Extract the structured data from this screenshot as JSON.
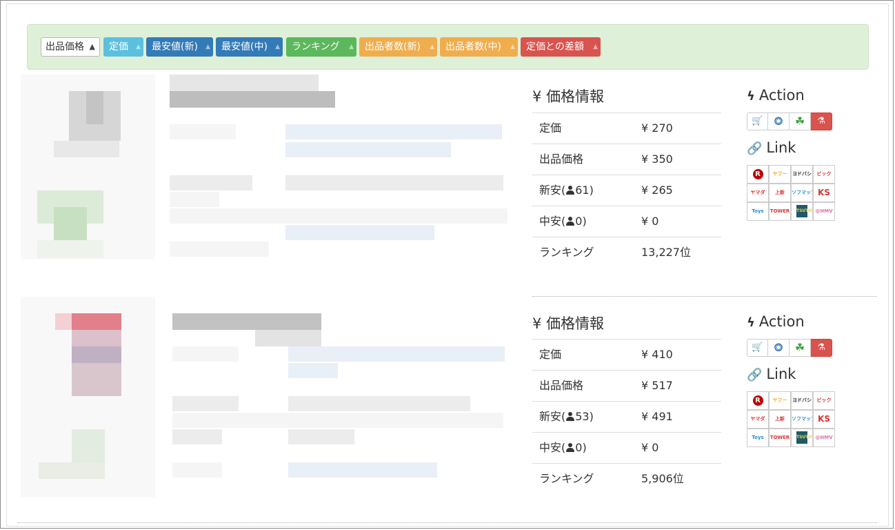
{
  "toolbar": {
    "select_value": "出品価格",
    "buttons": [
      {
        "label": "定価",
        "style": "info"
      },
      {
        "label": "最安値(新)",
        "style": "primary"
      },
      {
        "label": "最安値(中)",
        "style": "primary"
      },
      {
        "label": "ランキング",
        "style": "success"
      },
      {
        "label": "出品者数(新)",
        "style": "warning"
      },
      {
        "label": "出品者数(中)",
        "style": "warning"
      },
      {
        "label": "定価との差額",
        "style": "danger"
      }
    ]
  },
  "colors": {
    "info": "#5bc0de",
    "primary": "#337ab7",
    "success": "#5cb85c",
    "warning": "#f0ad4e",
    "danger": "#d9534f",
    "alert_bg": "#dff0d8"
  },
  "products": [
    {
      "price_title": "価格情報",
      "currency_icon": "¥",
      "list_price": {
        "label": "定価",
        "value": "¥ 270"
      },
      "listing_price": {
        "label": "出品価格",
        "value": "¥ 350"
      },
      "new_low": {
        "label_prefix": "新安(",
        "count": "61",
        "label_suffix": ")",
        "value": "¥ 265"
      },
      "used_low": {
        "label_prefix": "中安(",
        "count": "0",
        "label_suffix": ")",
        "value": "¥ 0"
      },
      "ranking": {
        "label": "ランキング",
        "value": "13,227位"
      },
      "action_title": "Action",
      "link_title": "Link"
    },
    {
      "price_title": "価格情報",
      "currency_icon": "¥",
      "list_price": {
        "label": "定価",
        "value": "¥ 410"
      },
      "listing_price": {
        "label": "出品価格",
        "value": "¥ 517"
      },
      "new_low": {
        "label_prefix": "新安(",
        "count": "53",
        "label_suffix": ")",
        "value": "¥ 491"
      },
      "used_low": {
        "label_prefix": "中安(",
        "count": "0",
        "label_suffix": ")",
        "value": "¥ 0"
      },
      "ranking": {
        "label": "ランキング",
        "value": "5,906位"
      },
      "action_title": "Action",
      "link_title": "Link"
    }
  ],
  "action_icons": [
    "cart-icon",
    "monitor-icon",
    "clover-icon",
    "flask-icon"
  ],
  "link_icons": [
    {
      "name": "rakuten-icon",
      "text": "R"
    },
    {
      "name": "yahoo-shopping-icon",
      "text": "ヤフー"
    },
    {
      "name": "yodobashi-icon",
      "text": "ヨドバシ"
    },
    {
      "name": "bic-camera-icon",
      "text": "ビック"
    },
    {
      "name": "yamada-icon",
      "text": "ヤマダ"
    },
    {
      "name": "joshin-icon",
      "text": "上新"
    },
    {
      "name": "sofmap-icon",
      "text": "ソフマップ"
    },
    {
      "name": "ks-denki-icon",
      "text": "KS"
    },
    {
      "name": "toysrus-icon",
      "text": "Toys"
    },
    {
      "name": "tower-records-icon",
      "text": "TOWER"
    },
    {
      "name": "tsutaya-icon",
      "text": "TSUTAYA"
    },
    {
      "name": "hmv-icon",
      "text": "@HMV"
    }
  ]
}
